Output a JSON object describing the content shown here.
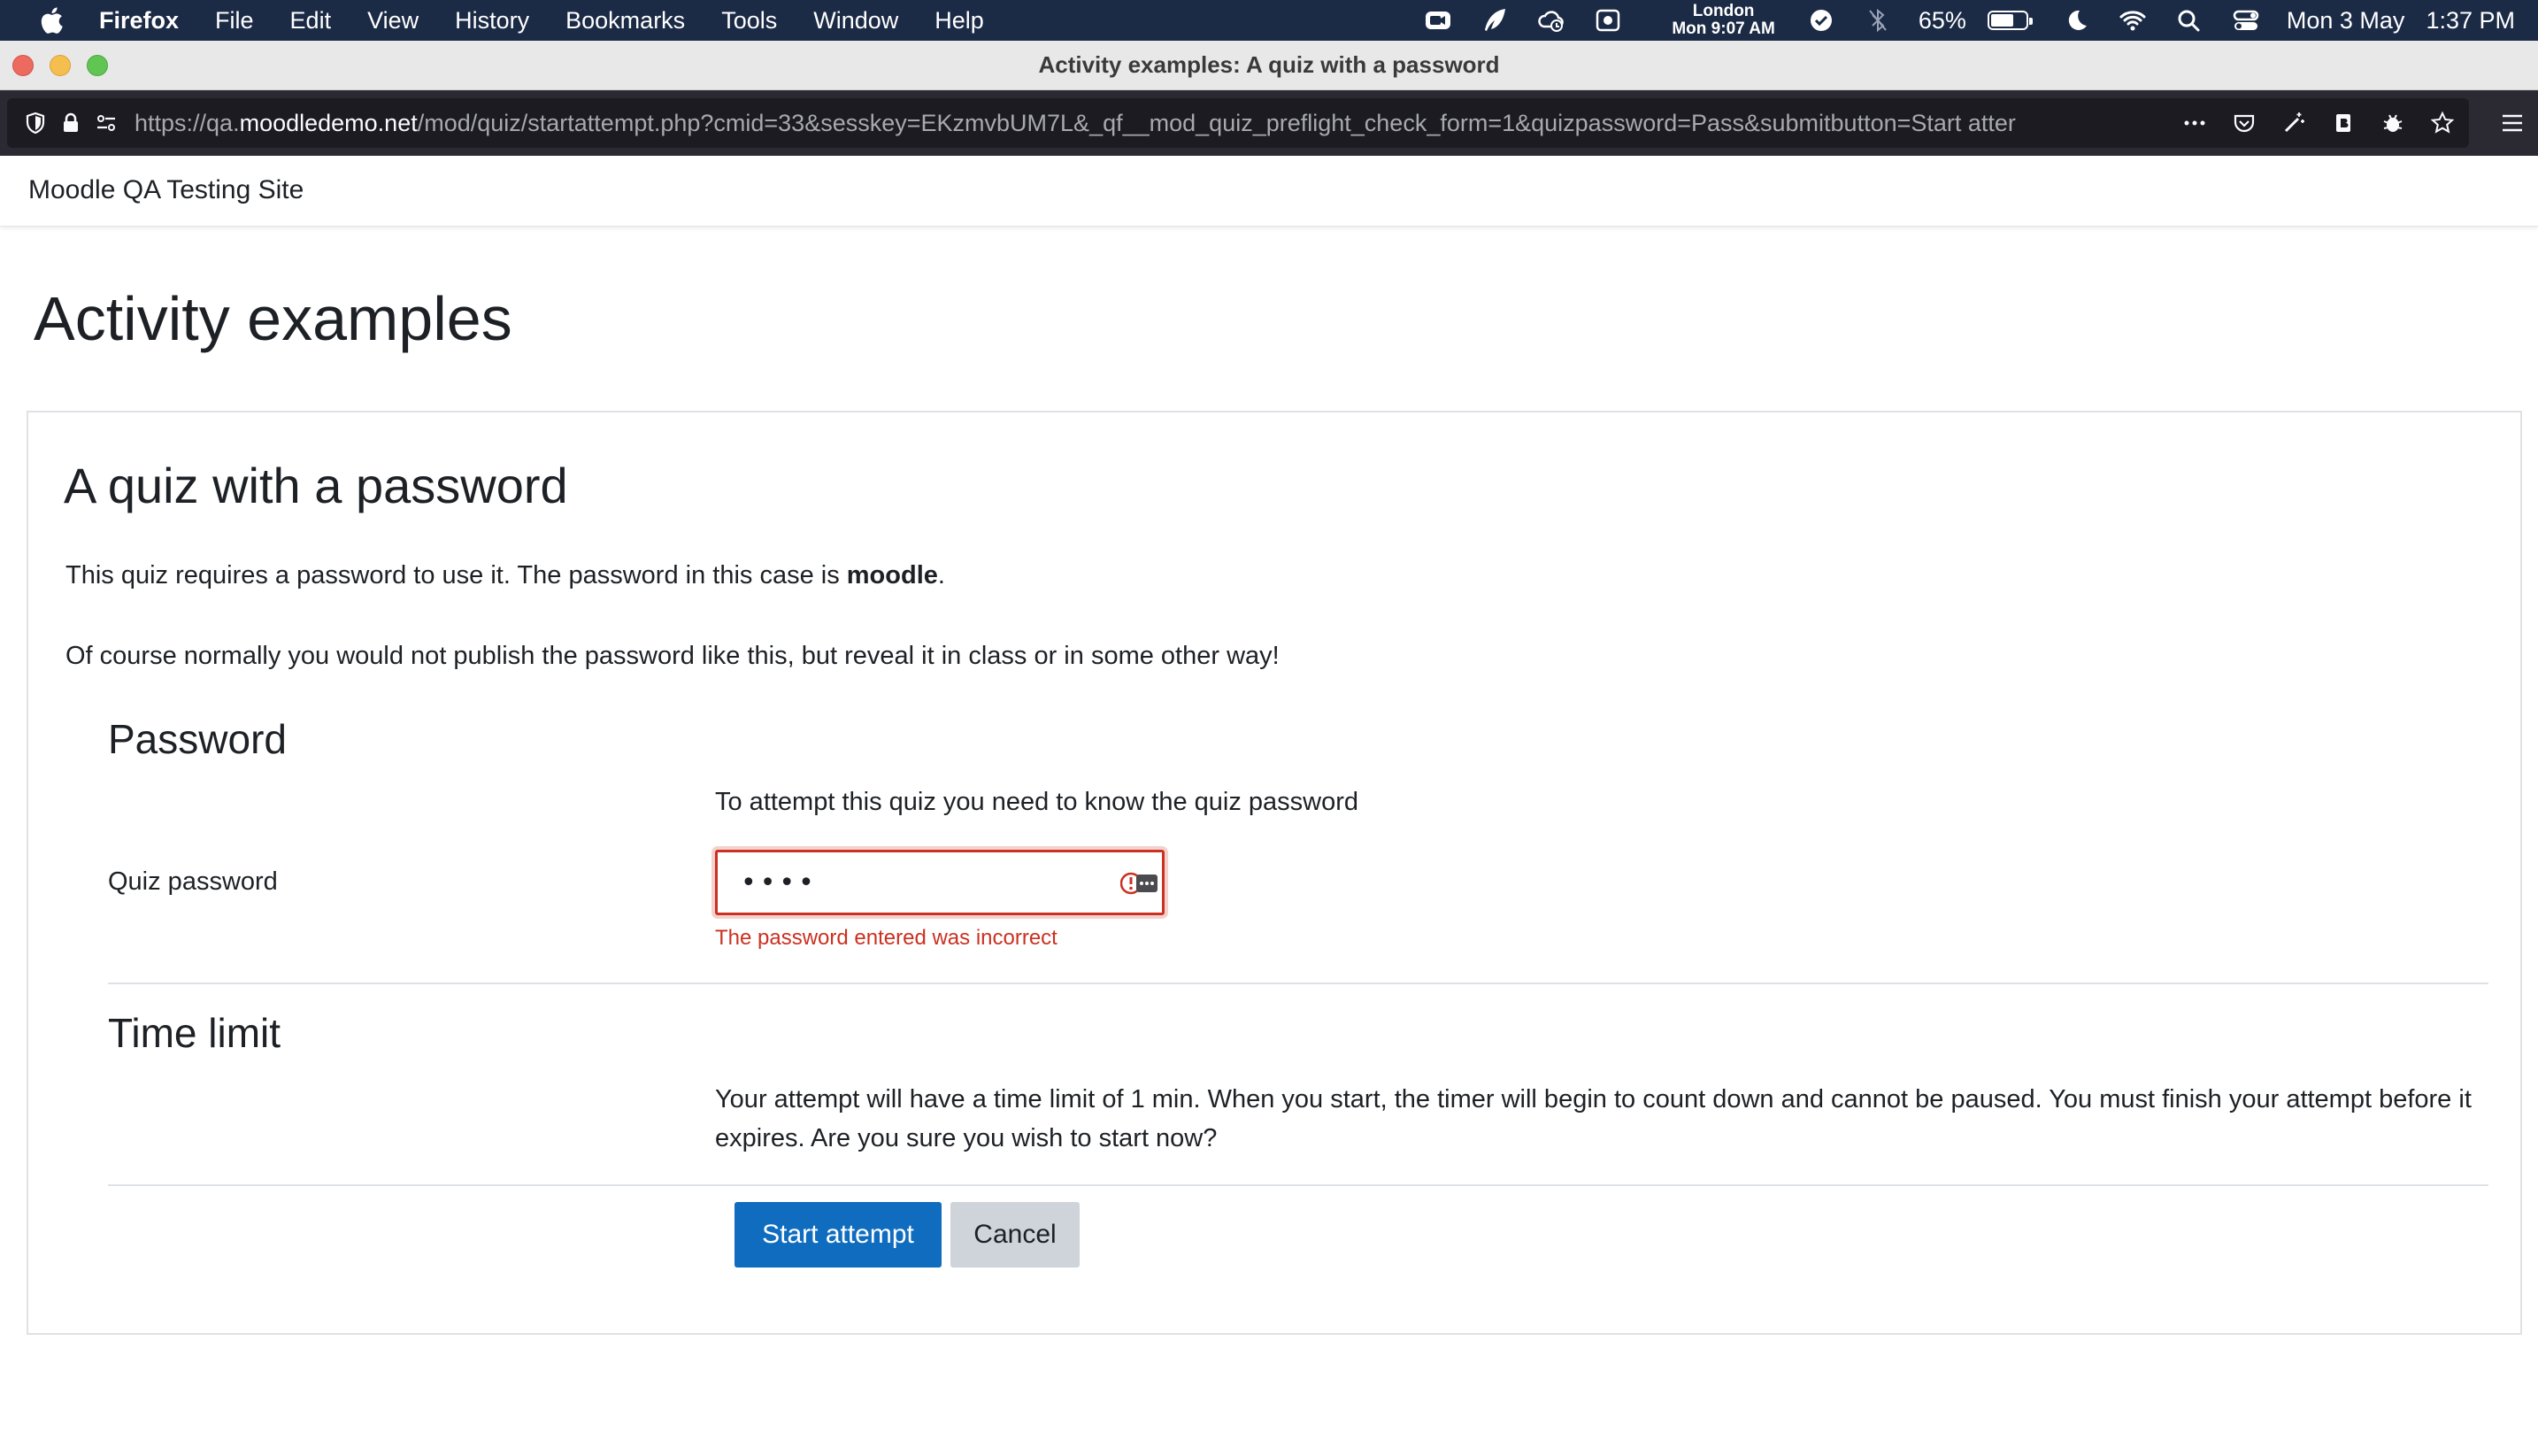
{
  "menubar": {
    "items": [
      "Firefox",
      "File",
      "Edit",
      "View",
      "History",
      "Bookmarks",
      "Tools",
      "Window",
      "Help"
    ],
    "clock_city": "London",
    "clock_time": "Mon 9:07 AM",
    "battery": "65%",
    "battery_level": 0.65,
    "datetime_date": "Mon 3 May",
    "datetime_time": "1:37 PM"
  },
  "window": {
    "title": "Activity examples: A quiz with a password"
  },
  "urlbar": {
    "prefix": "https://qa.",
    "domain": "moodledemo.net",
    "path": "/mod/quiz/startattempt.php?cmid=33&sesskey=EKzmvbUM7L&_qf__mod_quiz_preflight_check_form=1&quizpassword=Pass&submitbutton=Start atter"
  },
  "site": {
    "name": "Moodle QA Testing Site"
  },
  "page": {
    "heading": "Activity examples",
    "quiz_title": "A quiz with a password",
    "intro_p1_before": "This quiz requires a password to use it. The password in this case is ",
    "intro_p1_bold": "moodle",
    "intro_p1_after": ".",
    "intro_p2": "Of course normally you would not publish the password like this, but reveal it in class or in some other way!"
  },
  "password_section": {
    "title": "Password",
    "hint": "To attempt this quiz you need to know the quiz password",
    "label": "Quiz password",
    "value": "••••",
    "error": "The password entered was incorrect"
  },
  "time_section": {
    "title": "Time limit",
    "text": "Your attempt will have a time limit of 1 min. When you start, the timer will begin to count down and cannot be paused. You must finish your attempt before it expires. Are you sure you wish to start now?"
  },
  "buttons": {
    "start": "Start attempt",
    "cancel": "Cancel"
  },
  "colors": {
    "primary": "#0f6cbf",
    "error": "#ca3120",
    "secondary": "#ced4da"
  }
}
